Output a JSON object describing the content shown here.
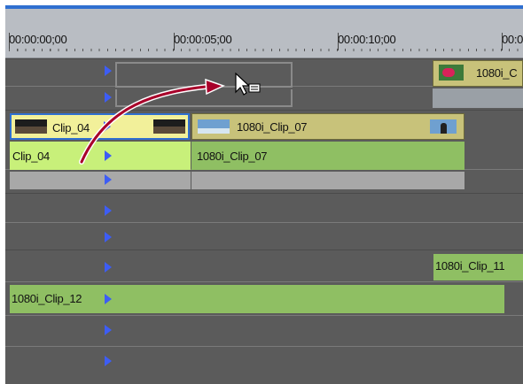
{
  "ruler": {
    "times": [
      "00:00:00;00",
      "00:00:05;00",
      "00:00:10;00",
      "00:0"
    ]
  },
  "clips": {
    "top_right_partial": "1080i_C",
    "clip04_video": "Clip_04",
    "clip07_video": "1080i_Clip_07",
    "clip04_audio": "Clip_04",
    "clip07_audio": "1080i_Clip_07",
    "clip11_partial": "1080i_Clip_11",
    "clip12": "1080i_Clip_12"
  },
  "colors": {
    "ruler_bg": "#b9bdc3",
    "video_clip_header": "#c8c27a",
    "selected_clip_header": "#f2f09a",
    "audio_clip": "#8fbf63",
    "audio_clip_selected": "#c8f07a",
    "marker_blue": "#3d5df5",
    "drag_arrow": "#a8002a"
  },
  "icons": {
    "in_marker": "triangle-right",
    "drag_cursor": "arrow-with-clip-icon"
  }
}
